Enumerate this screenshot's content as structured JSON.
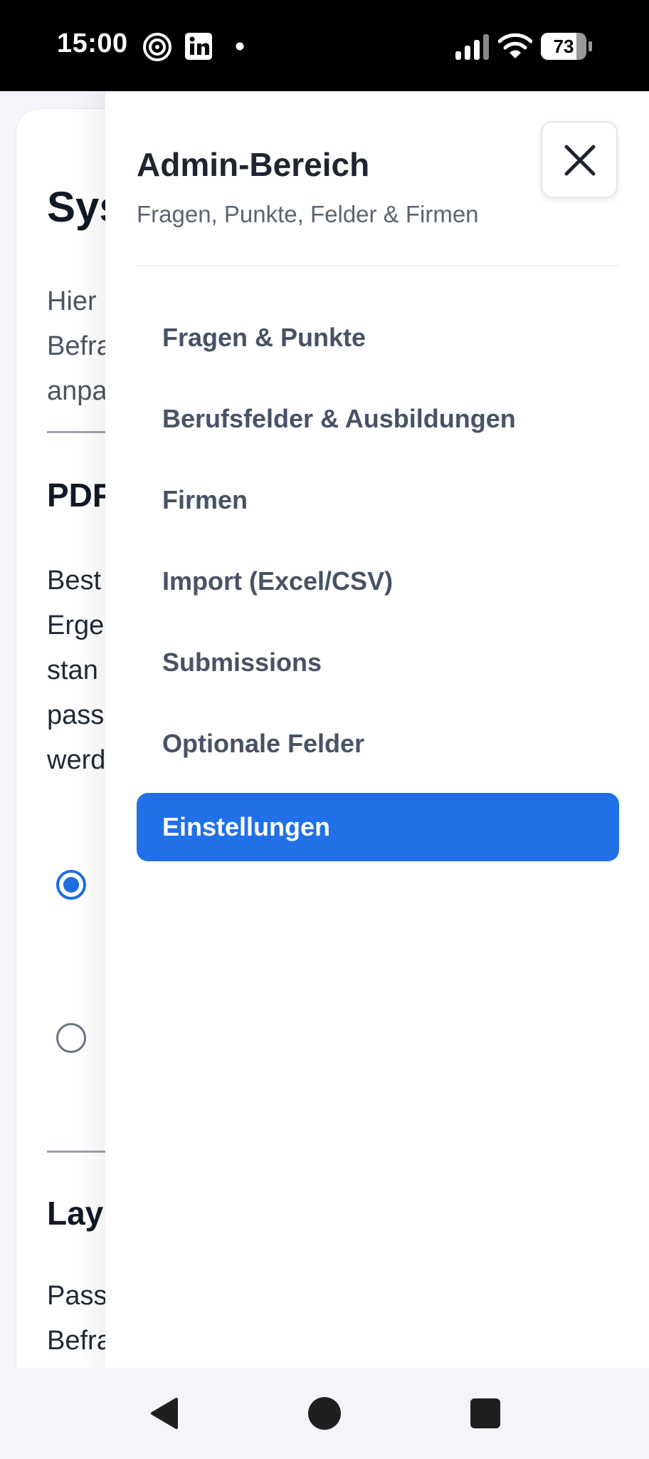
{
  "status_bar": {
    "time": "15:00",
    "battery": "73",
    "icons": [
      "threads-icon",
      "linkedin-icon",
      "notification-dot-icon",
      "signal-icon",
      "wifi-icon",
      "battery-icon"
    ]
  },
  "background_page": {
    "title_fragment": "Sys",
    "intro_lines": [
      "Hier",
      "Befra",
      "anpa"
    ],
    "section1_title_fragment": "PDF",
    "section1_lines": [
      "Best",
      "Erge",
      "stan",
      "pass",
      "werd"
    ],
    "section2_title_fragment": "Lay",
    "section2_lines": [
      "Pass",
      "Befra"
    ],
    "radio_selected_index": 0
  },
  "drawer": {
    "title": "Admin-Bereich",
    "subtitle": "Fragen, Punkte, Felder & Firmen",
    "close_icon": "close-icon",
    "menu": [
      {
        "label": "Fragen & Punkte"
      },
      {
        "label": "Berufsfelder & Ausbildungen"
      },
      {
        "label": "Firmen"
      },
      {
        "label": "Import (Excel/CSV)"
      },
      {
        "label": "Submissions"
      },
      {
        "label": "Optionale Felder"
      },
      {
        "label": "Einstellungen"
      }
    ],
    "active_item": "Einstellungen"
  },
  "colors": {
    "accent": "#2170e8",
    "radio_blue": "#1d6fe0",
    "menu_text": "#475266",
    "title_text": "#1f2430"
  },
  "nav_bar": {
    "icons": [
      "back-icon",
      "home-icon",
      "recents-icon"
    ]
  }
}
